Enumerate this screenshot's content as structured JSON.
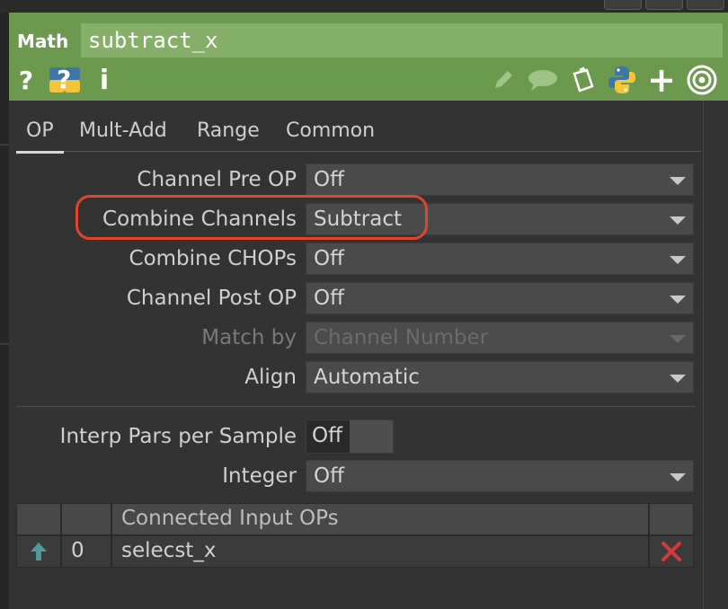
{
  "header": {
    "type_label": "Math",
    "name_value": "subtract_x"
  },
  "header_icons": {
    "help": "?",
    "python_help": "?",
    "info": "i",
    "add": "+"
  },
  "tabs": [
    {
      "label": "OP",
      "active": true
    },
    {
      "label": "Mult-Add",
      "active": false
    },
    {
      "label": "Range",
      "active": false
    },
    {
      "label": "Common",
      "active": false
    }
  ],
  "params": {
    "channel_pre_op": {
      "label": "Channel Pre OP",
      "value": "Off"
    },
    "combine_channels": {
      "label": "Combine Channels",
      "value": "Subtract"
    },
    "combine_chops": {
      "label": "Combine CHOPs",
      "value": "Off"
    },
    "channel_post_op": {
      "label": "Channel Post OP",
      "value": "Off"
    },
    "match_by": {
      "label": "Match by",
      "value": "Channel Number",
      "disabled": true
    },
    "align": {
      "label": "Align",
      "value": "Automatic"
    },
    "interp_pars": {
      "label": "Interp Pars per Sample",
      "value": "Off"
    },
    "integer": {
      "label": "Integer",
      "value": "Off"
    }
  },
  "inputs_table": {
    "header": "Connected Input OPs",
    "rows": [
      {
        "index": "0",
        "name": "selecst_x"
      }
    ]
  },
  "colors": {
    "header_green": "#6b9a4e",
    "name_field_green": "#86b06a",
    "highlight_red": "#e0452e",
    "delete_red": "#d43a3a",
    "arrow_teal": "#4e9a9e"
  }
}
